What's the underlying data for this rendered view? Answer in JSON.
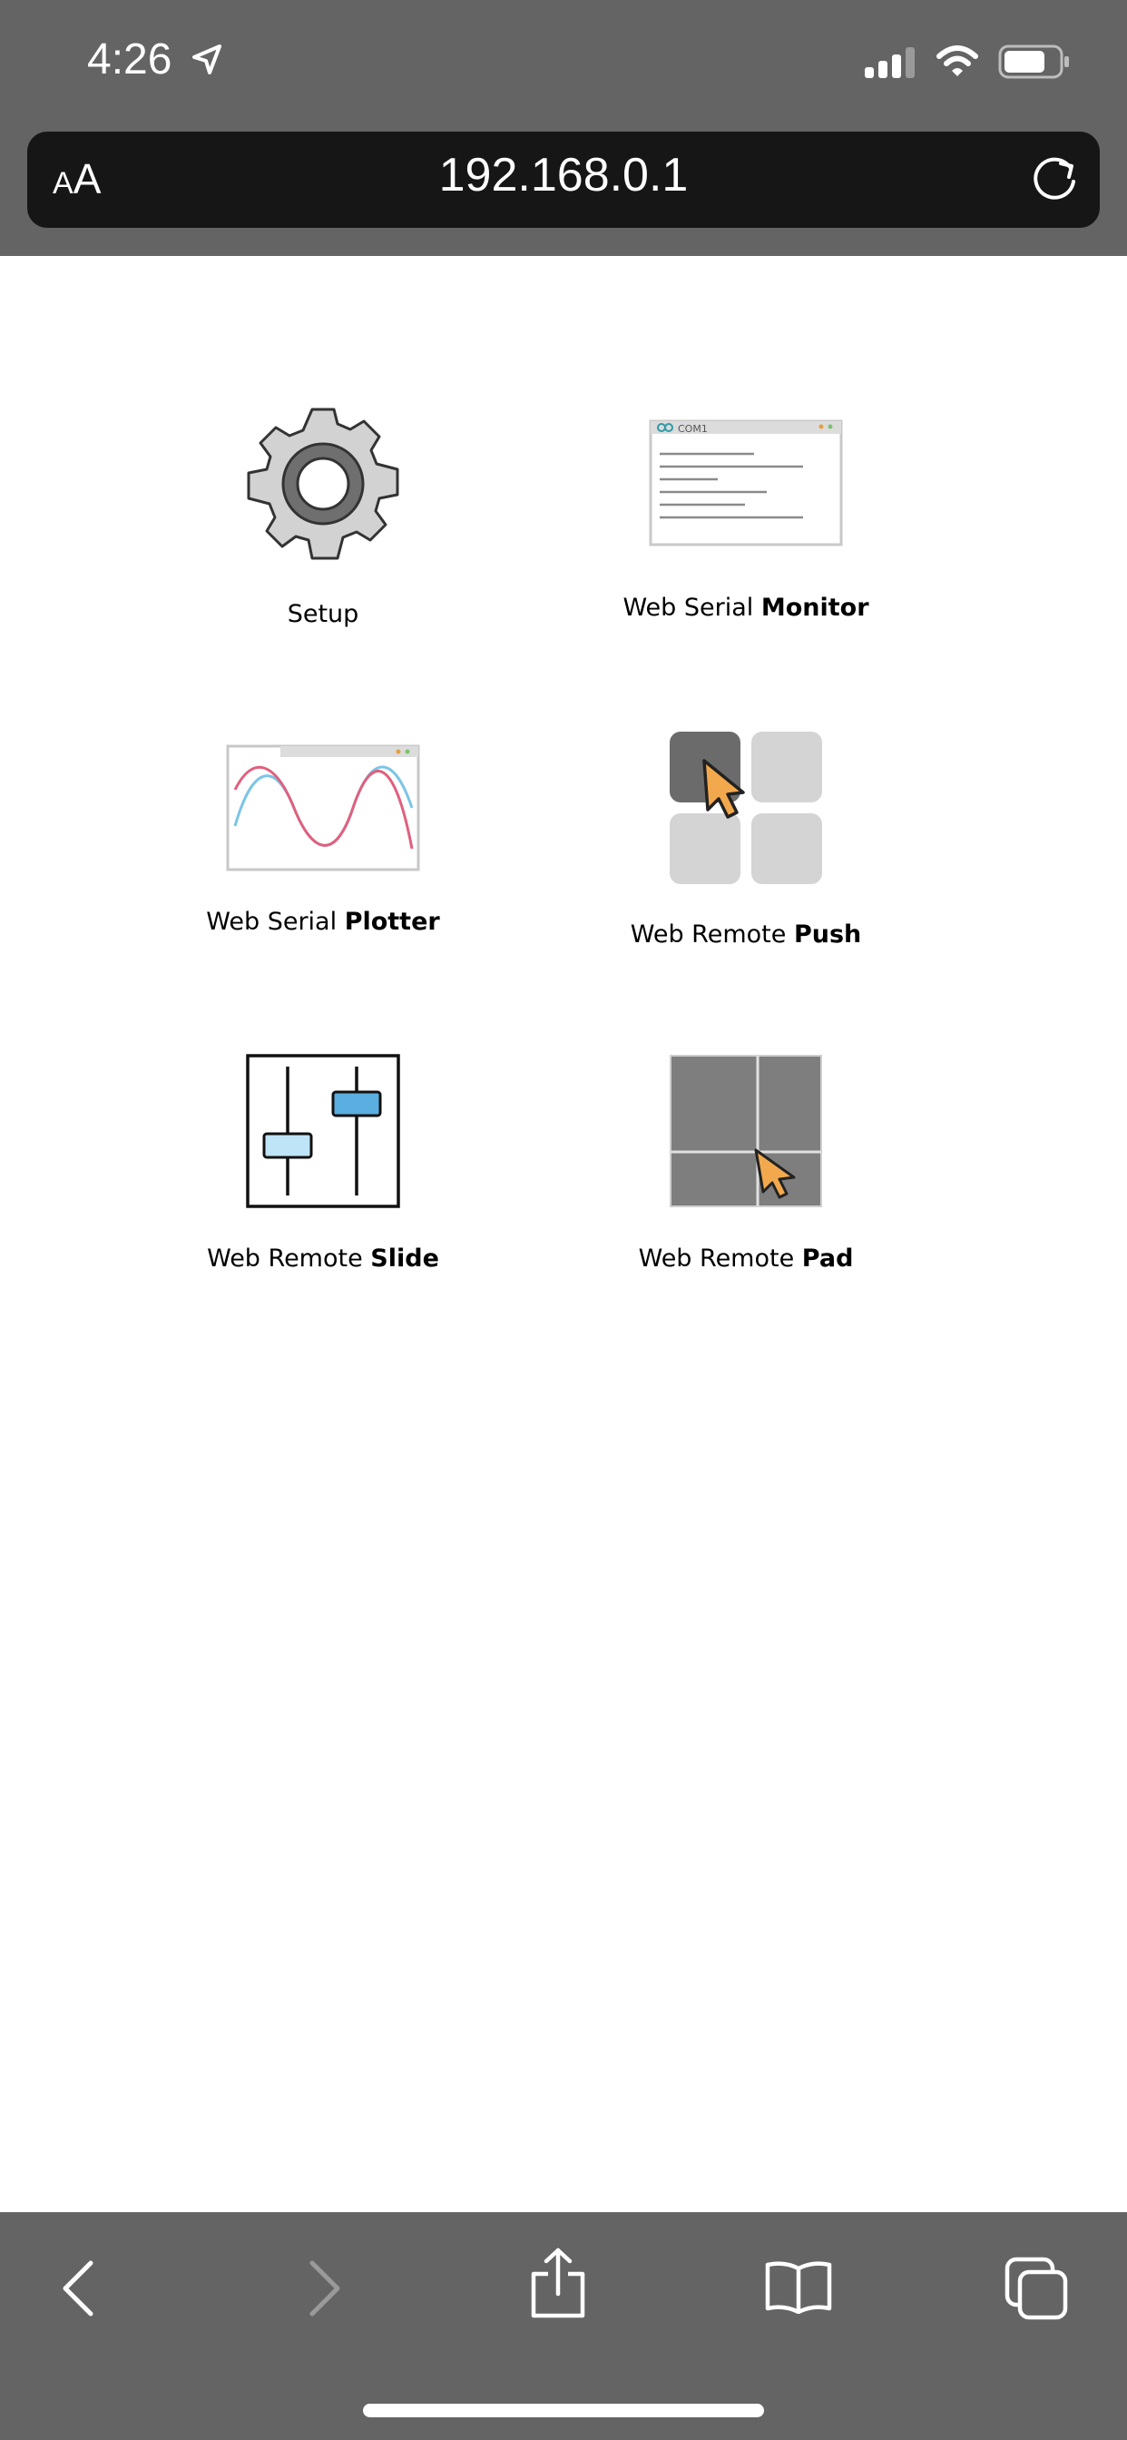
{
  "status_bar": {
    "time": "4:26",
    "icons": [
      "location-arrow-icon",
      "cellular-signal-icon",
      "wifi-icon",
      "battery-icon"
    ]
  },
  "address_bar": {
    "text_size_label_small": "A",
    "text_size_label_large": "A",
    "url": "192.168.0.1",
    "reload_icon": "reload-icon"
  },
  "menu": {
    "items": [
      {
        "icon": "gear-icon",
        "label_plain": "Setup",
        "label_bold": ""
      },
      {
        "icon": "serial-monitor-window-icon",
        "label_plain": "Web Serial ",
        "label_bold": "Monitor",
        "window_title": "COM1"
      },
      {
        "icon": "serial-plotter-wave-icon",
        "label_plain": "Web Serial ",
        "label_bold": "Plotter"
      },
      {
        "icon": "remote-push-buttons-icon",
        "label_plain": "Web Remote ",
        "label_bold": "Push"
      },
      {
        "icon": "remote-slider-icon",
        "label_plain": "Web Remote ",
        "label_bold": "Slide"
      },
      {
        "icon": "remote-touchpad-icon",
        "label_plain": "Web Remote ",
        "label_bold": "Pad"
      }
    ]
  },
  "toolbar": {
    "buttons": [
      "back-icon",
      "forward-icon",
      "share-icon",
      "bookmarks-icon",
      "tabs-icon"
    ]
  },
  "colors": {
    "chrome_gray": "#646464",
    "address_bar": "#161616",
    "cursor_orange": "#F2A94E",
    "wave_red": "#E0607E",
    "wave_blue": "#7CC5E6",
    "slider_blue": "#5AAEE0",
    "slider_light_blue": "#BFE3F7"
  }
}
